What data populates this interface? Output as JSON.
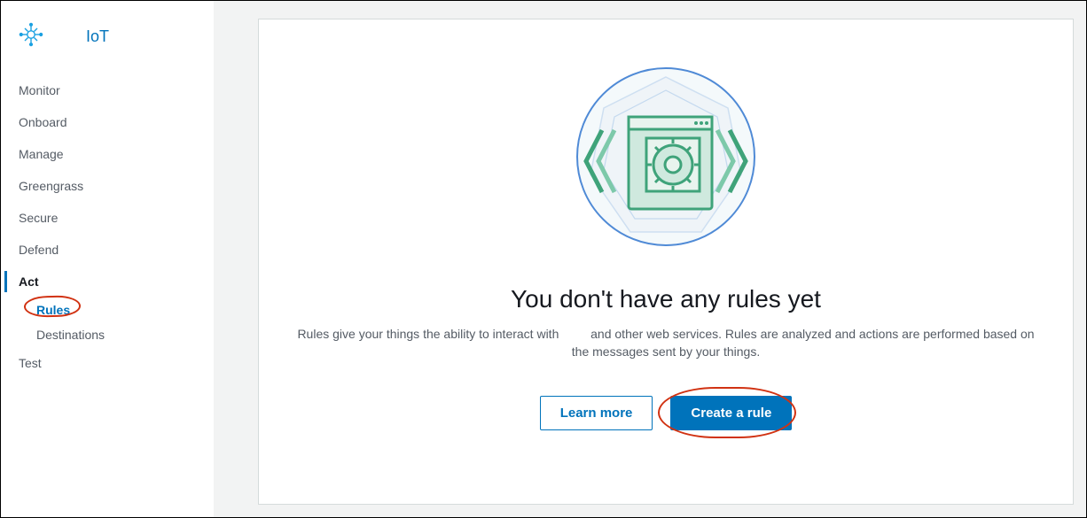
{
  "brand": {
    "text": "IoT"
  },
  "sidebar": {
    "items": [
      {
        "label": "Monitor"
      },
      {
        "label": "Onboard"
      },
      {
        "label": "Manage"
      },
      {
        "label": "Greengrass"
      },
      {
        "label": "Secure"
      },
      {
        "label": "Defend"
      },
      {
        "label": "Act"
      },
      {
        "label": "Test"
      }
    ],
    "act_sub": [
      {
        "label": "Rules"
      },
      {
        "label": "Destinations"
      }
    ]
  },
  "main": {
    "title": "You don't have any rules yet",
    "desc_pre": "Rules give your things the ability to interact with ",
    "desc_post": " and other web services. Rules are analyzed and actions are performed based on the messages sent by your things.",
    "learn_more": "Learn more",
    "create_rule": "Create a rule"
  }
}
